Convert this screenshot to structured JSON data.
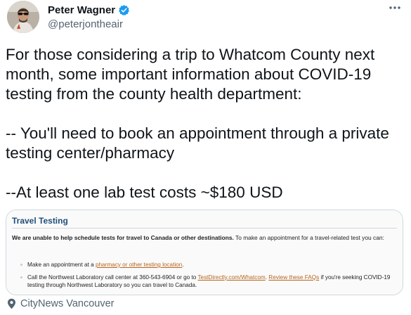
{
  "author": {
    "display_name": "Peter Wagner",
    "handle": "@peterjontheair"
  },
  "tweet": {
    "paragraphs": [
      "For those considering a trip to Whatcom County next month, some important information about COVID-19 testing from the county health department:",
      "-- You'll need to  book an appointment through a private testing center/pharmacy",
      "--At least one lab test costs ~$180 USD"
    ]
  },
  "card": {
    "title": "Travel Testing",
    "lead_bold": "We are unable to help schedule tests for travel to Canada or other destinations.",
    "lead_rest": " To make an appointment for a travel-related test you can:",
    "item1": {
      "prefix": "Make an appointment at a ",
      "link": "pharmacy or other testing location",
      "suffix": "."
    },
    "item2": {
      "prefix": "Call the Northwest Laboratory call center at 360-543-6904 or go to ",
      "link1": "TestDirectly.com/Whatcom",
      "middle": ". ",
      "link2": "Review these FAQs",
      "suffix": " if you're seeking COVID-19 testing through Northwest Laboratory so you can travel to Canada."
    }
  },
  "source": {
    "label": "CityNews Vancouver"
  },
  "colors": {
    "verified": "#1d9bf0",
    "card_title": "#1f4e79",
    "link": "#b5651d"
  },
  "icons": {
    "verified": "verified-badge-icon",
    "more": "more-horizontal-icon",
    "source": "location-pin-icon"
  }
}
